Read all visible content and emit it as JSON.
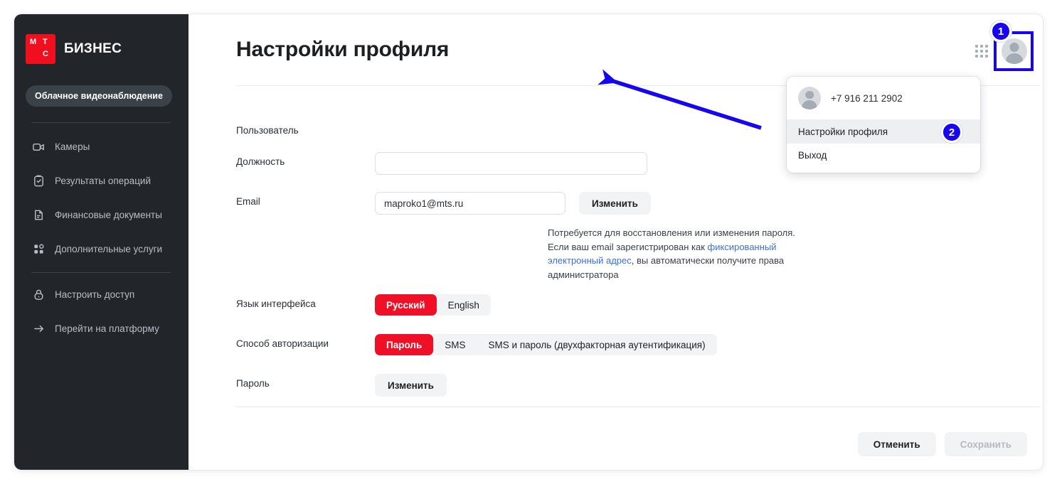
{
  "sidebar": {
    "brand": "БИЗНЕС",
    "logo_letters": {
      "m": "М",
      "t": "Т",
      "s": "С"
    },
    "service_pill": "Облачное видеонаблюдение",
    "items": [
      {
        "label": "Камеры",
        "icon": "camera-icon"
      },
      {
        "label": "Результаты операций",
        "icon": "clipboard-check-icon"
      },
      {
        "label": "Финансовые документы",
        "icon": "document-icon"
      },
      {
        "label": "Дополнительные услуги",
        "icon": "grid-squares-icon"
      },
      {
        "label": "Настроить доступ",
        "icon": "lock-icon"
      },
      {
        "label": "Перейти на платформу",
        "icon": "arrow-right-icon"
      }
    ]
  },
  "header": {
    "title": "Настройки профиля",
    "apps_icon": "apps-grid-icon",
    "avatar_icon": "user-avatar-icon"
  },
  "form": {
    "section_label": "Пользователь",
    "position": {
      "label": "Должность",
      "value": "",
      "placeholder": ""
    },
    "email": {
      "label": "Email",
      "value": "maproko1@mts.ru",
      "change_button": "Изменить",
      "hint_part1": "Потребуется для восстановления или изменения пароля. Если ваш email зарегистрирован как ",
      "hint_link": "фиксированный электронный адрес",
      "hint_part2": ", вы автоматически получите права администратора"
    },
    "language": {
      "label": "Язык интерфейса",
      "options": [
        "Русский",
        "English"
      ],
      "selected": "Русский"
    },
    "auth_method": {
      "label": "Способ авторизации",
      "options": [
        "Пароль",
        "SMS",
        "SMS и пароль (двухфакторная аутентификация)"
      ],
      "selected": "Пароль"
    },
    "password": {
      "label": "Пароль",
      "change_button": "Изменить"
    }
  },
  "actions": {
    "cancel": "Отменить",
    "save": "Сохранить"
  },
  "dropdown": {
    "phone": "+7 916 211 2902",
    "avatar_icon": "user-avatar-icon",
    "items": [
      {
        "label": "Настройки профиля",
        "highlighted": true
      },
      {
        "label": "Выход",
        "highlighted": false
      }
    ]
  },
  "annotations": {
    "badge_1": "1",
    "badge_2": "2",
    "accent_color": "#1705ef",
    "brand_red": "#ef0f1e"
  }
}
